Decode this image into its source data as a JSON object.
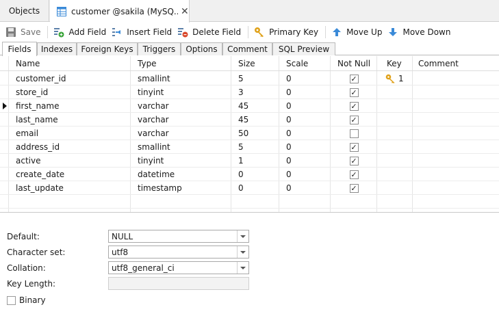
{
  "doc_tabs": {
    "objects_label": "Objects",
    "active_title": "customer @sakila (MySQ...",
    "close_glyph": "✕"
  },
  "toolbar": {
    "save": "Save",
    "add_field": "Add Field",
    "insert_field": "Insert Field",
    "delete_field": "Delete Field",
    "primary_key": "Primary Key",
    "move_up": "Move Up",
    "move_down": "Move Down"
  },
  "sub_tabs": [
    "Fields",
    "Indexes",
    "Foreign Keys",
    "Triggers",
    "Options",
    "Comment",
    "SQL Preview"
  ],
  "grid": {
    "headers": {
      "name": "Name",
      "type": "Type",
      "size": "Size",
      "scale": "Scale",
      "not_null": "Not Null",
      "key": "Key",
      "comment": "Comment"
    },
    "rows": [
      {
        "name": "customer_id",
        "type": "smallint",
        "size": "5",
        "scale": "0",
        "not_null": true,
        "key": "1"
      },
      {
        "name": "store_id",
        "type": "tinyint",
        "size": "3",
        "scale": "0",
        "not_null": true,
        "key": ""
      },
      {
        "name": "first_name",
        "type": "varchar",
        "size": "45",
        "scale": "0",
        "not_null": true,
        "key": ""
      },
      {
        "name": "last_name",
        "type": "varchar",
        "size": "45",
        "scale": "0",
        "not_null": true,
        "key": ""
      },
      {
        "name": "email",
        "type": "varchar",
        "size": "50",
        "scale": "0",
        "not_null": false,
        "key": ""
      },
      {
        "name": "address_id",
        "type": "smallint",
        "size": "5",
        "scale": "0",
        "not_null": true,
        "key": ""
      },
      {
        "name": "active",
        "type": "tinyint",
        "size": "1",
        "scale": "0",
        "not_null": true,
        "key": ""
      },
      {
        "name": "create_date",
        "type": "datetime",
        "size": "0",
        "scale": "0",
        "not_null": true,
        "key": ""
      },
      {
        "name": "last_update",
        "type": "timestamp",
        "size": "0",
        "scale": "0",
        "not_null": true,
        "key": ""
      }
    ],
    "check_glyph": "✓"
  },
  "props": {
    "default_label": "Default:",
    "default_value": "NULL",
    "charset_label": "Character set:",
    "charset_value": "utf8",
    "collation_label": "Collation:",
    "collation_value": "utf8_general_ci",
    "key_length_label": "Key Length:",
    "key_length_value": "",
    "binary_label": "Binary"
  },
  "colors": {
    "accent_blue": "#3a8ad8",
    "add_green": "#3aa43a",
    "delete_red": "#d9472b",
    "key_gold": "#e0a21b"
  }
}
